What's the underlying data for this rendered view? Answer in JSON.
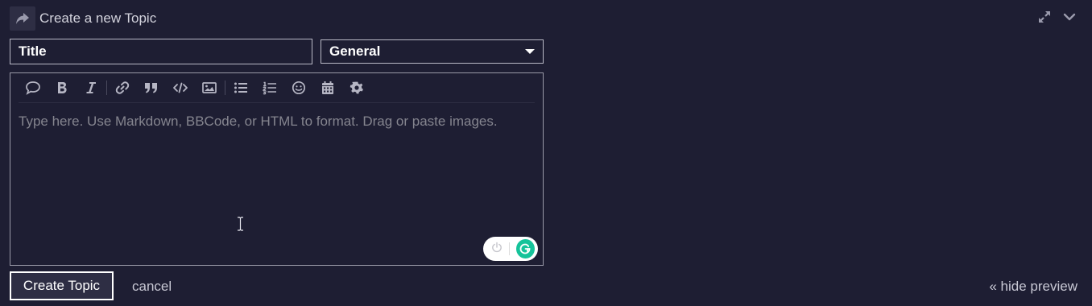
{
  "header": {
    "title": "Create a new Topic",
    "icon": "reply-arrow-icon"
  },
  "controls": {
    "expand_icon": "expand-arrows-icon",
    "collapse_icon": "chevron-down-icon"
  },
  "form": {
    "title_placeholder": "Title",
    "title_value": "",
    "category_selected": "General"
  },
  "toolbar": {
    "groups": [
      [
        "speech-bubble-icon",
        "bold-icon",
        "italic-icon"
      ],
      [
        "link-icon",
        "quote-icon",
        "code-icon",
        "image-icon"
      ],
      [
        "bullet-list-icon",
        "numbered-list-icon",
        "emoji-icon",
        "calendar-icon",
        "gear-icon"
      ]
    ]
  },
  "editor": {
    "placeholder": "Type here. Use Markdown, BBCode, or HTML to format. Drag or paste images."
  },
  "actions": {
    "submit_label": "Create Topic",
    "cancel_label": "cancel",
    "hide_preview_label": "« hide preview"
  },
  "colors": {
    "background": "#1e1e33",
    "button_bg": "#2e2e44",
    "grammarly": "#15c39a"
  }
}
